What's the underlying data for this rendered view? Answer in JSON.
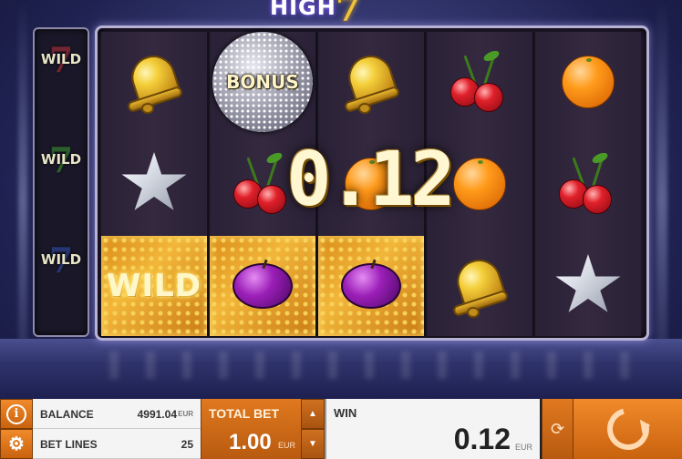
{
  "game": {
    "logo_text": "HIGH",
    "logo_seven": "7",
    "win_overlay": "0.12"
  },
  "side_reel": {
    "items": [
      {
        "seven": "7",
        "label": "WILD",
        "color": "#c0303a"
      },
      {
        "seven": "7",
        "label": "WILD",
        "color": "#3a9a30"
      },
      {
        "seven": "7",
        "label": "WILD",
        "color": "#3050b0"
      }
    ]
  },
  "reels": {
    "columns": [
      [
        {
          "symbol": "bell-icon"
        },
        {
          "symbol": "star-icon"
        },
        {
          "symbol": "wild",
          "label": "WILD",
          "lit": true
        }
      ],
      [
        {
          "symbol": "bonus",
          "label": "BONUS"
        },
        {
          "symbol": "cherry-icon"
        },
        {
          "symbol": "plum-icon",
          "lit": true
        }
      ],
      [
        {
          "symbol": "bell-icon"
        },
        {
          "symbol": "orange-icon"
        },
        {
          "symbol": "plum-icon",
          "lit": true
        }
      ],
      [
        {
          "symbol": "cherry-icon"
        },
        {
          "symbol": "orange-icon"
        },
        {
          "symbol": "bell-icon"
        }
      ],
      [
        {
          "symbol": "orange-icon"
        },
        {
          "symbol": "cherry-icon"
        },
        {
          "symbol": "star-icon"
        }
      ]
    ]
  },
  "controls": {
    "info_icon": "i",
    "settings_icon": "gear-icon",
    "balance_label": "BALANCE",
    "balance_value": "4991.04",
    "balance_unit": "EUR",
    "betlines_label": "BET LINES",
    "betlines_value": "25",
    "totalbet_label": "TOTAL BET",
    "totalbet_value": "1.00",
    "totalbet_unit": "EUR",
    "up_arrow": "▲",
    "down_arrow": "▼",
    "win_label": "WIN",
    "win_value": "0.12",
    "win_unit": "EUR",
    "autoplay_icon": "⟳"
  },
  "colors": {
    "accent_orange": "#e0791f",
    "panel_light": "#f4f4f4"
  }
}
